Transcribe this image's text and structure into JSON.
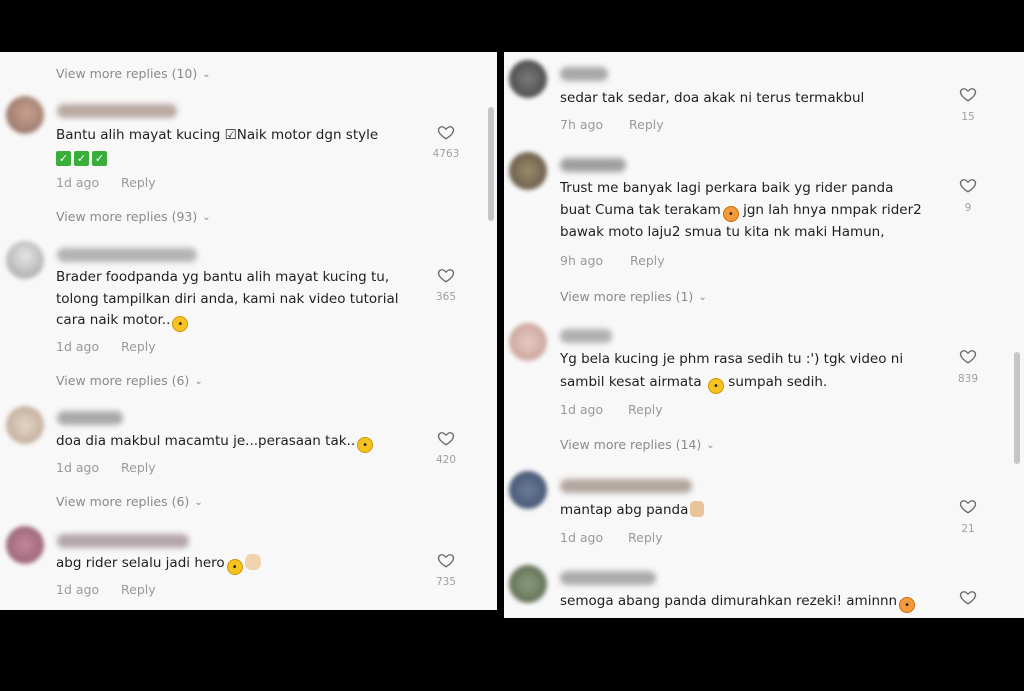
{
  "left": {
    "top_view_more": "View more replies (10)",
    "comments": [
      {
        "text_lines": [
          "Bantu alih mayat kucing ☑Naik motor dgn style"
        ],
        "emoji_line": "✅✅✅",
        "time": "1d ago",
        "reply": "Reply",
        "likes": "4763",
        "view_more": "View more replies (93)"
      },
      {
        "text_lines": [
          "Brader foodpanda yg bantu alih mayat kucing tu,",
          "tolong tampilkan diri anda, kami nak video tutorial",
          "cara naik motor.."
        ],
        "time": "1d ago",
        "reply": "Reply",
        "likes": "365",
        "view_more": "View more replies (6)"
      },
      {
        "text_lines": [
          "doa dia makbul macamtu je...perasaan tak.."
        ],
        "time": "1d ago",
        "reply": "Reply",
        "likes": "420",
        "view_more": "View more replies (6)"
      },
      {
        "text_lines": [
          "abg rider selalu jadi hero"
        ],
        "time": "1d ago",
        "reply": "Reply",
        "likes": "735"
      }
    ]
  },
  "right": {
    "comments": [
      {
        "text_lines": [
          "sedar tak sedar, doa akak ni terus termakbul"
        ],
        "time": "7h ago",
        "reply": "Reply",
        "likes": "15"
      },
      {
        "text_lines": [
          "Trust me banyak lagi perkara baik yg rider panda",
          "buat Cuma tak terakam",
          "bawak moto laju2 smua tu kita nk maki Hamun,"
        ],
        "line2_suffix": "jgn lah hnya nmpak rider2",
        "time": "9h ago",
        "reply": "Reply",
        "likes": "9",
        "view_more": "View more replies (1)"
      },
      {
        "text_lines": [
          "Yg bela kucing je phm rasa sedih tu :') tgk video ni",
          "sambil kesat airmata"
        ],
        "line2_suffix": "sumpah sedih.",
        "time": "1d ago",
        "reply": "Reply",
        "likes": "839",
        "view_more": "View more replies (14)"
      },
      {
        "text_lines": [
          "mantap abg panda"
        ],
        "time": "1d ago",
        "reply": "Reply",
        "likes": "21"
      },
      {
        "text_lines": [
          "semoga abang panda dimurahkan rezeki! aminnn"
        ],
        "likes": ""
      }
    ]
  },
  "icons": {
    "heart": "heart-outline-icon",
    "chevron": "chevron-down-icon"
  },
  "colors": {
    "panel_bg": "#f8f8f8",
    "text": "#1f1f1f",
    "meta": "#9a9a9a",
    "background": "#000000"
  }
}
